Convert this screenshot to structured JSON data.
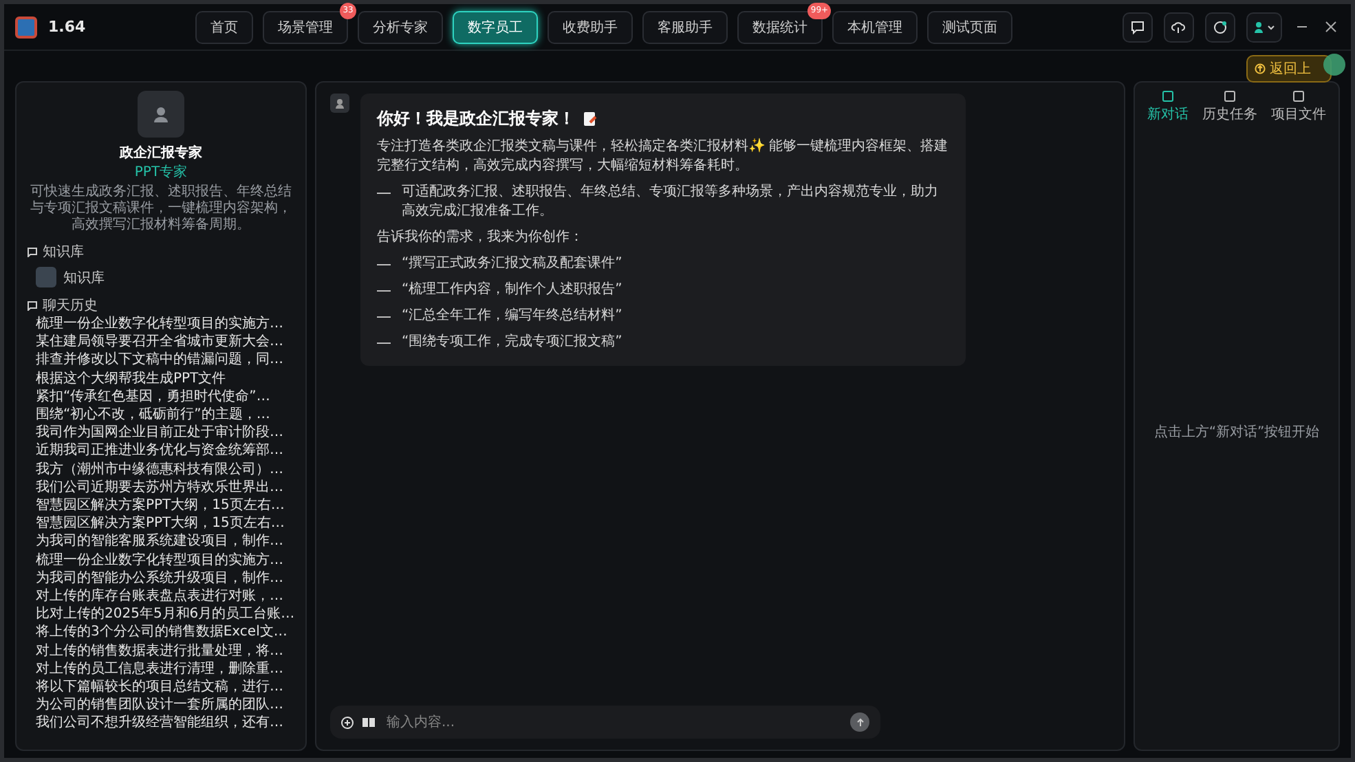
{
  "topbar": {
    "version": "1.64",
    "nav": [
      {
        "label": "首页",
        "selected": false
      },
      {
        "label": "场景管理",
        "selected": false,
        "badge": "33"
      },
      {
        "label": "分析专家",
        "selected": false
      },
      {
        "label": "数字员工",
        "selected": true
      },
      {
        "label": "收费助手",
        "selected": false
      },
      {
        "label": "客服助手",
        "selected": false
      },
      {
        "label": "数据统计",
        "selected": false,
        "badge": "99+"
      },
      {
        "label": "本机管理",
        "selected": false
      },
      {
        "label": "测试页面",
        "selected": false
      }
    ],
    "back_button": "返回上"
  },
  "sidebar": {
    "agent": {
      "name": "政企汇报专家",
      "tag": "PPT专家",
      "description": "可快速生成政务汇报、述职报告、年终总结与专项汇报文稿课件，一键梳理内容架构，高效撰写汇报材料筹备周期。"
    },
    "knowledge": {
      "title": "知识库",
      "items": [
        "知识库"
      ]
    },
    "history": {
      "title": "聊天历史",
      "items": [
        "梳理一份企业数字化转型项目的实施方…",
        "某住建局领导要召开全省城市更新大会…",
        "排查并修改以下文稿中的错漏问题，同…",
        "根据这个大纲帮我生成PPT文件",
        "紧扣“传承红色基因，勇担时代使命”…",
        "围绕“初心不改，砥砺前行”的主题，…",
        "我司作为国网企业目前正处于审计阶段…",
        "近期我司正推进业务优化与资金统筹部…",
        "我方（潮州市中缘德惠科技有限公司）…",
        "我们公司近期要去苏州方特欢乐世界出…",
        "智慧园区解决方案PPT大纲，15页左右…",
        "智慧园区解决方案PPT大纲，15页左右…",
        "为我司的智能客服系统建设项目，制作…",
        "梳理一份企业数字化转型项目的实施方…",
        "为我司的智能办公系统升级项目，制作…",
        "对上传的库存台账表盘点表进行对账，…",
        "比对上传的2025年5月和6月的员工台账…",
        "将上传的3个分公司的销售数据Excel文…",
        "对上传的销售数据表进行批量处理，将…",
        "对上传的员工信息表进行清理，删除重…",
        "将以下篇幅较长的项目总结文稿，进行…",
        "为公司的销售团队设计一套所属的团队…",
        "我们公司不想升级经营智能组织，还有…"
      ]
    }
  },
  "chat": {
    "welcome": {
      "title": "你好！我是政企汇报专家！",
      "intro": "专注打造各类政企汇报类文稿与课件，轻松搞定各类汇报材料✨ 能够一键梳理内容框架、搭建完整行文结构，高效完成内容撰写，大幅缩短材料筹备耗时。",
      "features": [
        "可适配政务汇报、述职报告、年终总结、专项汇报等多种场景，产出内容规范专业，助力高效完成汇报准备工作。"
      ],
      "prompt": "告诉我你的需求，我来为你创作：",
      "examples": [
        "“撰写正式政务汇报文稿及配套课件”",
        "“梳理工作内容，制作个人述职报告”",
        "“汇总全年工作，编写年终总结材料”",
        "“围绕专项工作，完成专项汇报文稿”"
      ]
    },
    "input": {
      "placeholder": "输入内容..."
    }
  },
  "right_panel": {
    "tabs": [
      {
        "label": "新对话",
        "selected": true
      },
      {
        "label": "历史任务",
        "selected": false
      },
      {
        "label": "项目文件",
        "selected": false
      }
    ],
    "empty_text": "点击上方“新对话”按钮开始"
  }
}
